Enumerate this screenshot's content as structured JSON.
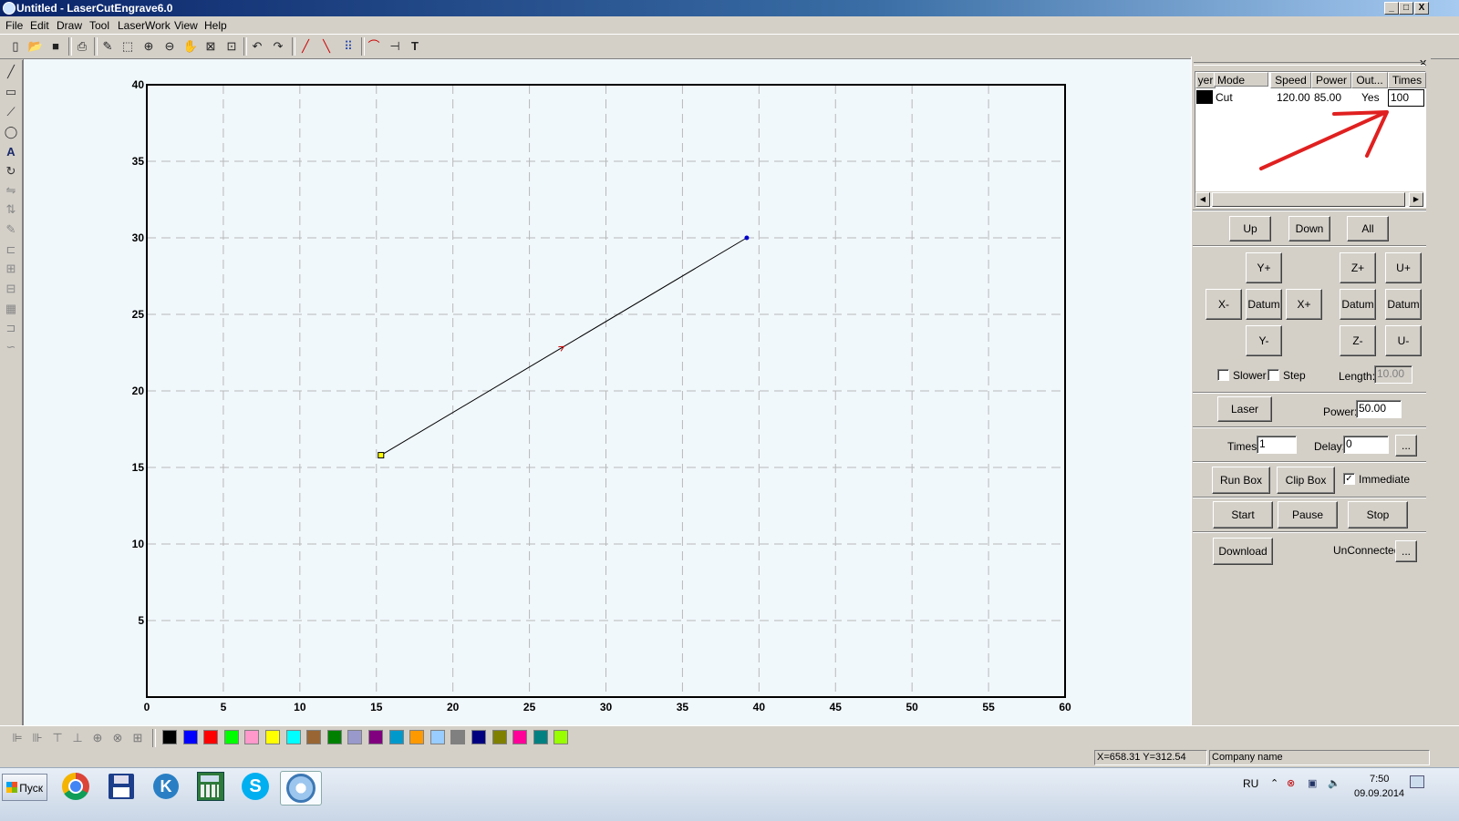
{
  "window": {
    "title": "Untitled - LaserCutEngrave6.0",
    "min_label": "_",
    "max_label": "□",
    "close_label": "X"
  },
  "menu": [
    "File",
    "Edit",
    "Draw",
    "Tool",
    "LaserWork",
    "View",
    "Help"
  ],
  "toolbar_icons": [
    "new-file-icon",
    "open-folder-icon",
    "save-icon",
    "print-preview-icon",
    "node-edit-icon",
    "select-region-icon",
    "zoom-in-icon",
    "zoom-out-icon",
    "pan-hand-icon",
    "zoom-fit-icon",
    "zoom-page-icon",
    "undo-icon",
    "redo-icon",
    "line-direction-icon",
    "start-point-icon",
    "array-icon",
    "arc-icon",
    "measure-icon",
    "text-tool-icon"
  ],
  "left_tools": [
    "line-tool-icon",
    "rectangle-tool-icon",
    "polyline-tool-icon",
    "ellipse-tool-icon",
    "text-tool-icon",
    "rotate-icon",
    "mirror-horizontal-icon",
    "mirror-vertical-icon",
    "edit-nodes-icon",
    "align-icon",
    "group-icon",
    "ungroup-icon",
    "hatch-icon",
    "offset-icon",
    "curve-icon"
  ],
  "chart_data": {
    "type": "line",
    "x_ticks": [
      "0",
      "5",
      "10",
      "15",
      "20",
      "25",
      "30",
      "35",
      "40",
      "45",
      "50",
      "55",
      "60"
    ],
    "y_ticks": [
      "5",
      "10",
      "15",
      "20",
      "25",
      "30",
      "35",
      "40"
    ],
    "xlim": [
      0,
      60
    ],
    "ylim": [
      0,
      40
    ],
    "grid": true,
    "series": [
      {
        "points": [
          [
            15.3,
            15.8
          ],
          [
            39.2,
            30.0
          ]
        ],
        "color": "#000000"
      }
    ],
    "start_marker_color": "#ffff00",
    "end_marker_color": "#0000cc",
    "direction_arrow_color": "#cc0000"
  },
  "layer_table": {
    "columns": [
      "yer",
      "Mode",
      "Speed",
      "Power",
      "Out...",
      "Times"
    ],
    "rows": [
      {
        "color": "#000000",
        "mode": "Cut",
        "speed": "120.00",
        "power": "85.00",
        "output": "Yes",
        "times": "100"
      }
    ],
    "annotation_arrow_color": "#e02020"
  },
  "panel": {
    "up": "Up",
    "down": "Down",
    "all": "All",
    "y_plus": "Y+",
    "y_minus": "Y-",
    "x_minus": "X-",
    "x_plus": "X+",
    "datum": "Datum",
    "z_plus": "Z+",
    "z_minus": "Z-",
    "u_plus": "U+",
    "u_minus": "U-",
    "slower": "Slower",
    "step": "Step",
    "length_label": "Length:",
    "length_value": "10.00",
    "laser": "Laser",
    "power_label": "Power:",
    "power_value": "50.00",
    "times_label": "Times:",
    "times_value": "1",
    "delay_label": "Delay:",
    "delay_value": "0",
    "ellipsis": "...",
    "run_box": "Run Box",
    "clip_box": "Clip Box",
    "immediate": "Immediate",
    "immediate_checked": true,
    "start": "Start",
    "pause": "Pause",
    "stop": "Stop",
    "download": "Download",
    "connection": "UnConnected"
  },
  "palette": [
    "#000000",
    "#0000ff",
    "#ff0000",
    "#00ff00",
    "#ff99cc",
    "#ffff00",
    "#00ffff",
    "#996633",
    "#008000",
    "#9999cc",
    "#800080",
    "#0099cc",
    "#ff9900",
    "#99ccff",
    "#808080",
    "#000080",
    "#808000",
    "#ff0099",
    "#008080",
    "#99ff00"
  ],
  "status": {
    "coords": "X=658.31 Y=312.54",
    "company": "Company name"
  },
  "taskbar": {
    "start_label": "Пуск",
    "lang": "RU",
    "time": "7:50",
    "date": "09.09.2014",
    "apps": [
      "chrome-icon",
      "floppy-disk-icon",
      "k-app-icon",
      "calculator-icon",
      "skype-icon",
      "lasercut-app-icon"
    ]
  }
}
